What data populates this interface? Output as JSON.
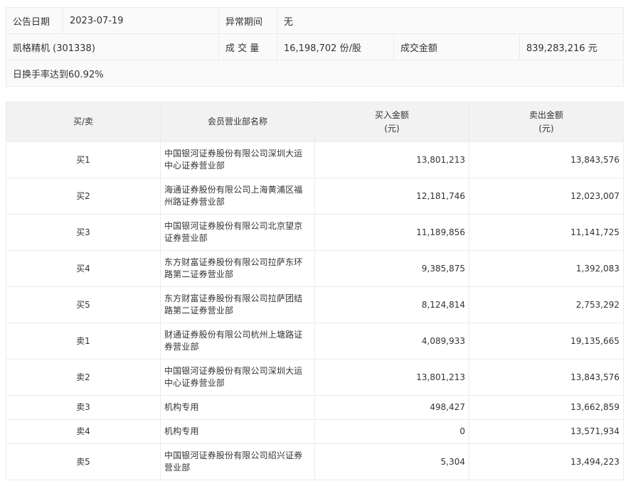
{
  "info": {
    "date_label": "公告日期",
    "date_value": "2023-07-19",
    "period_label": "异常期间",
    "period_value": "无",
    "stock": "凯格精机 (301338)",
    "volume_label": "成 交 量",
    "volume_value": "16,198,702 份/股",
    "amount_label": "成交金额",
    "amount_value": "839,283,216 元",
    "reason": "日换手率达到60.92%"
  },
  "table": {
    "headers": {
      "side": "买/卖",
      "name": "会员营业部名称",
      "buy_line1": "买入金额",
      "buy_line2": "(元)",
      "sell_line1": "卖出金额",
      "sell_line2": "(元)"
    },
    "rows": [
      {
        "side": "买1",
        "name": "中国银河证券股份有限公司深圳大运中心证券营业部",
        "buy": "13,801,213",
        "sell": "13,843,576"
      },
      {
        "side": "买2",
        "name": "海通证券股份有限公司上海黄浦区福州路证券营业部",
        "buy": "12,181,746",
        "sell": "12,023,007"
      },
      {
        "side": "买3",
        "name": "中国银河证券股份有限公司北京望京证券营业部",
        "buy": "11,189,856",
        "sell": "11,141,725"
      },
      {
        "side": "买4",
        "name": "东方财富证券股份有限公司拉萨东环路第二证券营业部",
        "buy": "9,385,875",
        "sell": "1,392,083"
      },
      {
        "side": "买5",
        "name": "东方财富证券股份有限公司拉萨团结路第二证券营业部",
        "buy": "8,124,814",
        "sell": "2,753,292"
      },
      {
        "side": "卖1",
        "name": "财通证券股份有限公司杭州上塘路证券营业部",
        "buy": "4,089,933",
        "sell": "19,135,665"
      },
      {
        "side": "卖2",
        "name": "中国银河证券股份有限公司深圳大运中心证券营业部",
        "buy": "13,801,213",
        "sell": "13,843,576"
      },
      {
        "side": "卖3",
        "name": "机构专用",
        "buy": "498,427",
        "sell": "13,662,859"
      },
      {
        "side": "卖4",
        "name": "机构专用",
        "buy": "0",
        "sell": "13,571,934"
      },
      {
        "side": "卖5",
        "name": "中国银河证券股份有限公司绍兴证券营业部",
        "buy": "5,304",
        "sell": "13,494,223"
      }
    ]
  }
}
